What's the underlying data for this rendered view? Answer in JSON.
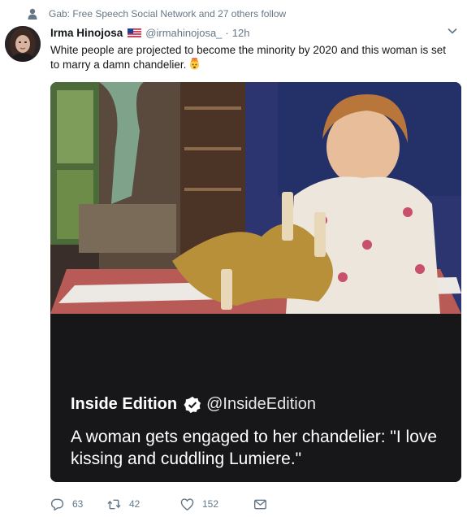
{
  "social_context": {
    "icon": "person-icon",
    "text": "Gab: Free Speech Social Network and 27 others follow"
  },
  "tweet": {
    "author_name": "Irma Hinojosa",
    "flag_icon": "us-flag-icon",
    "handle": "@irmahinojosa_",
    "separator": "·",
    "time": "12h",
    "text": "White people are projected to  become the minority by 2020 and this woman is set to marry a damn chandelier.",
    "emoji_icon": "exploding-head-emoji"
  },
  "media": {
    "source_name": "Inside Edition",
    "verified_icon": "verified-badge-icon",
    "source_handle": "@InsideEdition",
    "caption": "A woman gets engaged to her chandelier: \"I love kissing and cuddling Lumiere.\""
  },
  "actions": {
    "reply_count": "63",
    "retweet_count": "42",
    "like_count": "152"
  },
  "colors": {
    "secondary_text": "#657786",
    "primary_text": "#14171a",
    "media_dark": "#17171a"
  }
}
